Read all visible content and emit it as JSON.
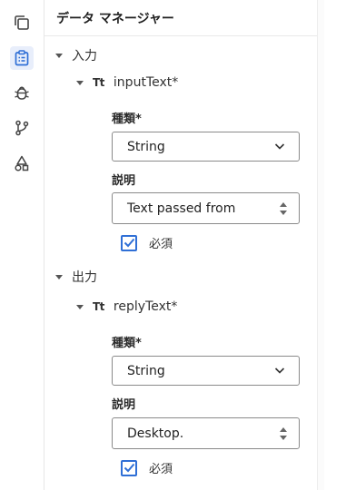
{
  "panel": {
    "title": "データ マネージャー"
  },
  "rail": {
    "items": [
      {
        "icon": "copy-icon",
        "active": false
      },
      {
        "icon": "clipboard-list-icon",
        "active": true
      },
      {
        "icon": "bug-icon",
        "active": false
      },
      {
        "icon": "branch-icon",
        "active": false
      },
      {
        "icon": "shapes-icon",
        "active": false
      }
    ]
  },
  "sections": {
    "input": {
      "label": "入力",
      "variable": {
        "type_glyph": "Tt",
        "name": "inputText*"
      },
      "kind_label": "種類*",
      "kind_value": "String",
      "desc_label": "説明",
      "desc_value": "Text passed from",
      "required_label": "必須",
      "required_checked": true
    },
    "output": {
      "label": "出力",
      "variable": {
        "type_glyph": "Tt",
        "name": "replyText*"
      },
      "kind_label": "種類*",
      "kind_value": "String",
      "desc_label": "説明",
      "desc_value": "Desktop.",
      "required_label": "必須",
      "required_checked": true
    }
  },
  "colors": {
    "accent": "#2f6fd6",
    "active_rail_bg": "#e8eefb",
    "border": "#8a8a8a"
  }
}
